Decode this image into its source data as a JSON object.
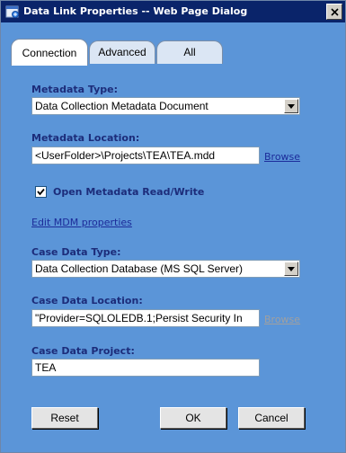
{
  "window": {
    "title": "Data Link Properties -- Web Page Dialog"
  },
  "tabs": [
    {
      "label": "Connection",
      "active": true
    },
    {
      "label": "Advanced",
      "active": false
    },
    {
      "label": "All",
      "active": false
    }
  ],
  "metadata_type": {
    "label": "Metadata Type:",
    "value": "Data Collection Metadata Document"
  },
  "metadata_location": {
    "label": "Metadata Location:",
    "value": "<UserFolder>\\Projects\\TEA\\TEA.mdd",
    "browse": "Browse"
  },
  "open_rw": {
    "label": "Open Metadata Read/Write",
    "checked": true
  },
  "edit_mdm": {
    "label": "Edit MDM properties"
  },
  "case_data_type": {
    "label": "Case Data Type:",
    "value": "Data Collection Database (MS SQL Server)"
  },
  "case_data_location": {
    "label": "Case Data Location:",
    "value": "\"Provider=SQLOLEDB.1;Persist Security In",
    "browse": "Browse"
  },
  "case_data_project": {
    "label": "Case Data Project:",
    "value": "TEA"
  },
  "buttons": {
    "reset": "Reset",
    "ok": "OK",
    "cancel": "Cancel"
  },
  "colors": {
    "label": "#1c2c7a",
    "link": "#1c2c9a",
    "titlebar": "#0a246a",
    "client": "#5b95d8"
  },
  "icons": {
    "app": "dialog-app-icon",
    "close": "close-icon",
    "dropdown": "chevron-down-icon",
    "check": "check-icon"
  }
}
